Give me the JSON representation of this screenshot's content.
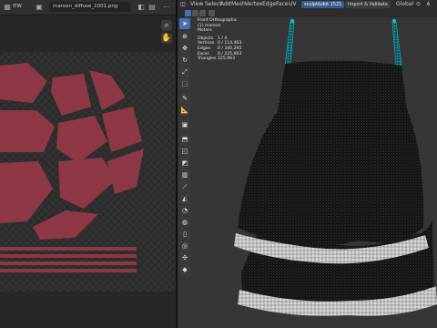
{
  "image_editor": {
    "filename": "maroon_diffuse_1001.png",
    "pattern_color": "#8e3847",
    "menu_glyph": "⋯"
  },
  "viewport": {
    "menu": [
      "View",
      "Select",
      "Add",
      "Mesh",
      "Vertex",
      "Edge",
      "Face",
      "UV"
    ],
    "collection_tab": "sculpt&dot.1521",
    "import_export": "Import & Validate",
    "orientation": "Global",
    "overlay": {
      "view_name": "Front Orthographic",
      "object_name": "(1) maroon",
      "units": "Meters",
      "stats": [
        {
          "label": "Objects",
          "value": "1 / 4"
        },
        {
          "label": "Vertices",
          "value": "0 / 114,463"
        },
        {
          "label": "Edges",
          "value": "0 / 340,295"
        },
        {
          "label": "Faces",
          "value": "0 / 225,963"
        },
        {
          "label": "Triangles",
          "value": "225,963"
        }
      ]
    },
    "colors": {
      "background": "#363636",
      "mesh": "#0b0b0b",
      "strap": "#1fb5c2",
      "fur": "#d7d7d7",
      "accent": "#4772b3"
    },
    "tools": [
      "select-box",
      "cursor",
      "move",
      "rotate",
      "scale",
      "transform",
      "annotate",
      "measure",
      "add-cube",
      "extrude",
      "inset",
      "bevel",
      "loop-cut",
      "knife",
      "poly-build",
      "spin",
      "smooth",
      "edge-slide",
      "shrink-fatten",
      "shear",
      "rip-region"
    ]
  }
}
